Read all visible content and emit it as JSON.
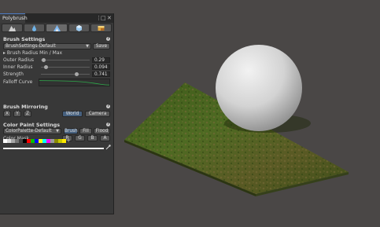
{
  "window": {
    "tab_title": "Polybrush",
    "menu_glyph": "⋮",
    "maximize_glyph": "□",
    "close_glyph": "✕"
  },
  "toolbar": {
    "tools": [
      {
        "icon": "raise-lower-sculpt-icon",
        "active": false
      },
      {
        "icon": "smooth-droplet-icon",
        "active": false
      },
      {
        "icon": "paint-vertex-color-icon",
        "active": true
      },
      {
        "icon": "scatter-prefab-icon",
        "active": false
      },
      {
        "icon": "texture-blend-icon",
        "active": false
      }
    ]
  },
  "brush_settings": {
    "header": "Brush Settings",
    "preset": "BrushSettings-Default",
    "save_label": "Save",
    "radius_toggle_label": "Brush Radius Min / Max",
    "outer_radius": {
      "label": "Outer Radius",
      "value": "0.29",
      "fraction": 0.05
    },
    "inner_radius": {
      "label": "Inner Radius",
      "value": "0.094",
      "fraction": 0.1
    },
    "strength": {
      "label": "Strength",
      "value": "0.741",
      "fraction": 0.741
    },
    "falloff_label": "Falloff Curve"
  },
  "brush_mirroring": {
    "header": "Brush Mirroring",
    "axes": [
      "X",
      "Y",
      "Z"
    ],
    "world_label": "World",
    "camera_label": "Camera",
    "active_space": "World"
  },
  "color_paint": {
    "header": "Color Paint Settings",
    "palette": "ColorPalette-Default",
    "modes": [
      "Brush",
      "Fill",
      "Flood"
    ],
    "active_mode": "Brush",
    "mask_label": "Color Mask",
    "mask_channels": [
      "R",
      "G",
      "B",
      "A"
    ],
    "swatches": [
      "#ffffff",
      "#d9d9d9",
      "#a6a6a6",
      "#737373",
      "#404040",
      "#000000",
      "#ff0000",
      "#00c000",
      "#0000ff",
      "#ffff00",
      "#00ffff",
      "#ff00ff",
      "#9b9b9b",
      "#8a8a00",
      "#c8c800",
      "#ffea00"
    ],
    "add_glyph": "+",
    "brush_color": "#f0f0f0"
  },
  "colors": {
    "accent": "#4c7cc4",
    "curve": "#2ea84a"
  }
}
